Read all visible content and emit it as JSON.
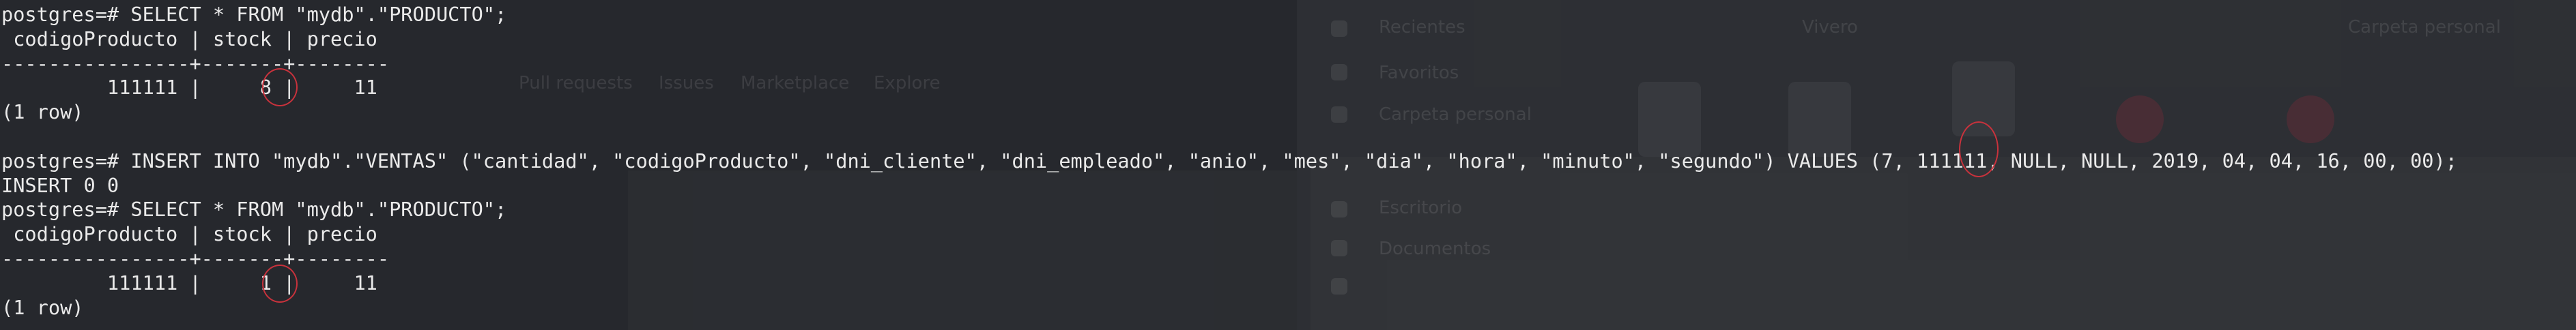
{
  "terminal": {
    "lines": [
      {
        "segments": [
          "postgres=# SELECT * FROM \"mydb\".\"PRODUCTO\";"
        ]
      },
      {
        "segments": [
          " codigoProducto | stock | precio"
        ]
      },
      {
        "segments": [
          "----------------+-------+--------"
        ]
      },
      {
        "segments": [
          "         111111 |     ",
          "8",
          " |     11"
        ]
      },
      {
        "segments": [
          "(1 row)"
        ]
      },
      {
        "segments": [
          ""
        ]
      },
      {
        "segments": [
          "postgres=# INSERT INTO \"mydb\".\"VENTAS\" (\"cantidad\", \"codigoProducto\", \"dni_cliente\", \"dni_empleado\", \"anio\", \"mes\", \"dia\", \"hora\", \"minuto\", \"segundo\") VALUES (",
          "7",
          ", 111111, NULL, NULL, 2019, 04, 04, 16, 00, 00);"
        ]
      },
      {
        "segments": [
          "INSERT 0 0"
        ]
      },
      {
        "segments": [
          "postgres=# SELECT * FROM \"mydb\".\"PRODUCTO\";"
        ]
      },
      {
        "segments": [
          " codigoProducto | stock | precio"
        ]
      },
      {
        "segments": [
          "----------------+-------+--------"
        ]
      },
      {
        "segments": [
          "         111111 |     ",
          "1",
          " |     11"
        ]
      },
      {
        "segments": [
          "(1 row)"
        ]
      }
    ]
  },
  "background_ghost": {
    "labels": [
      "Pull requests",
      "Issues",
      "Marketplace",
      "Explore",
      "Recientes",
      "Favoritos",
      "Carpeta personal",
      "Escritorio",
      "Documentos",
      "Vivero",
      "Carpeta personal"
    ]
  },
  "colors": {
    "background": "#26282d",
    "text": "#eaeaea",
    "highlight_circle": "#c8323c"
  }
}
